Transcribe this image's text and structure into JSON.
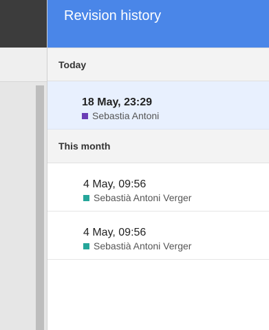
{
  "panel": {
    "title": "Revision history"
  },
  "sections": [
    {
      "label": "Today",
      "revisions": [
        {
          "date": "18 May, 23:29",
          "author": "Sebastia Antoni",
          "color": "#6a3db5",
          "selected": true
        }
      ]
    },
    {
      "label": "This month",
      "revisions": [
        {
          "date": "4 May, 09:56",
          "author": "Sebastià Antoni Verger",
          "color": "#26a69a",
          "selected": false
        },
        {
          "date": "4 May, 09:56",
          "author": "Sebastià Antoni Verger",
          "color": "#26a69a",
          "selected": false
        }
      ]
    }
  ]
}
